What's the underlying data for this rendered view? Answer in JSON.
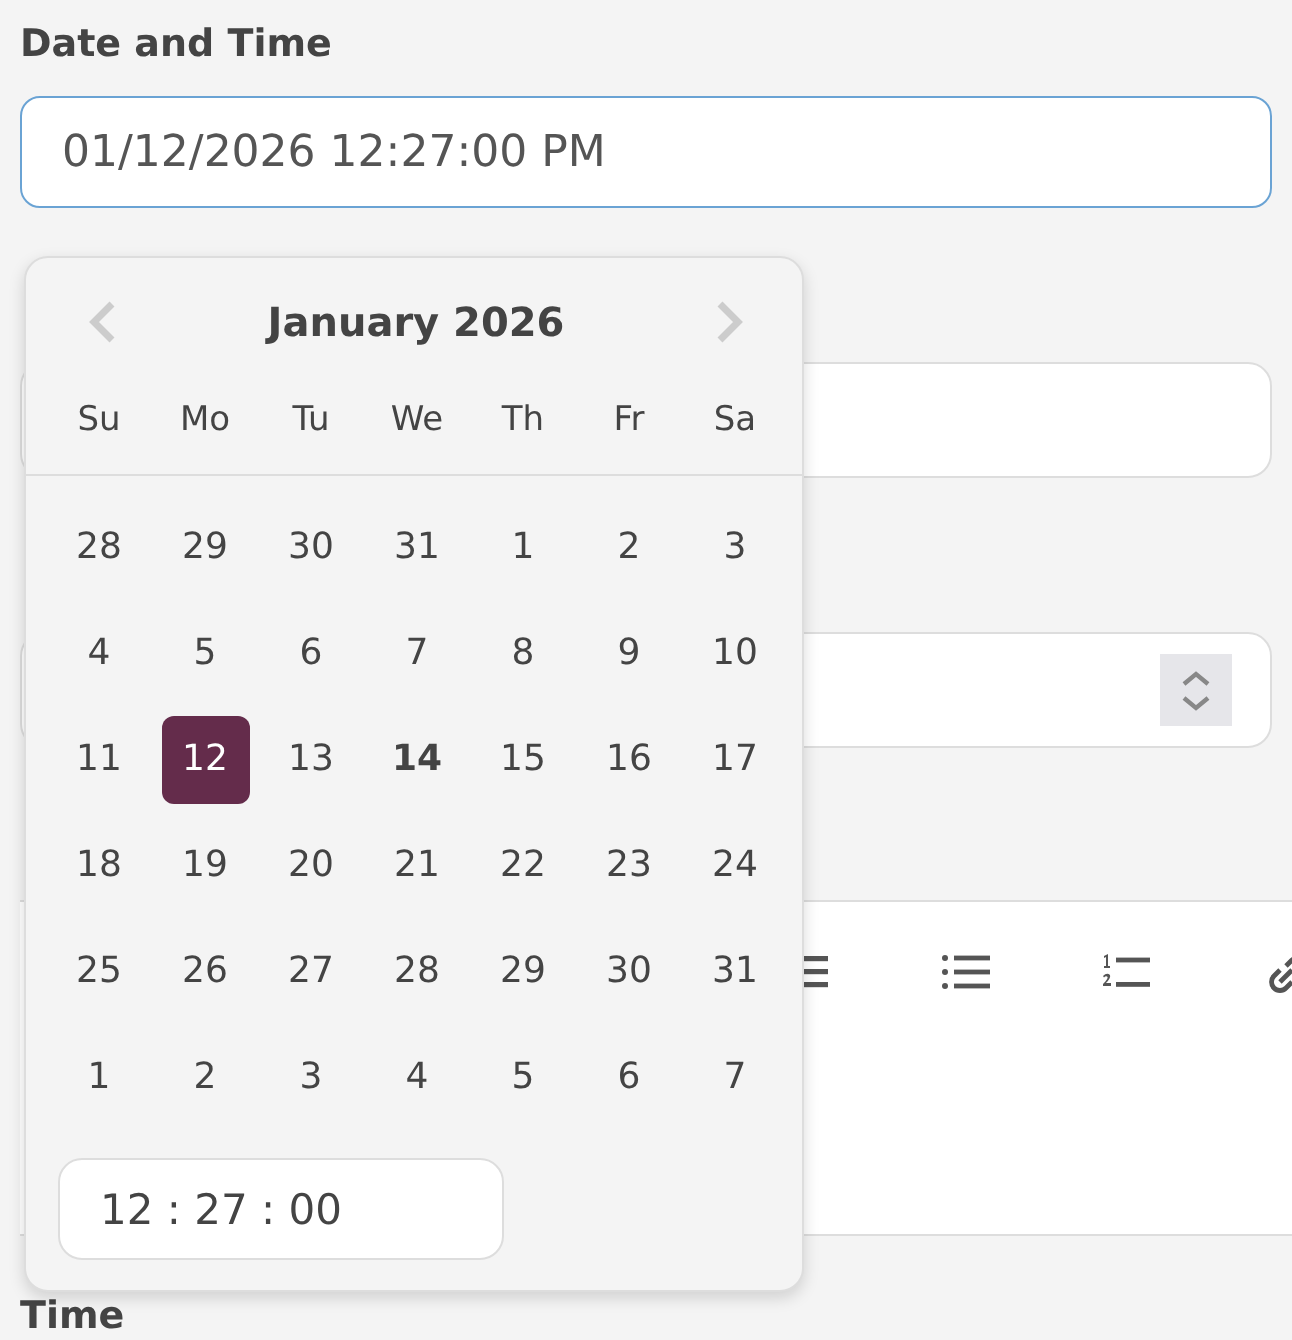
{
  "field": {
    "label": "Date and Time",
    "value": "01/12/2026 12:27:00 PM",
    "focused": true
  },
  "datepicker": {
    "title": "January 2026",
    "weekdays": [
      "Su",
      "Mo",
      "Tu",
      "We",
      "Th",
      "Fr",
      "Sa"
    ],
    "weeks": [
      [
        {
          "day": "28",
          "selected": false,
          "today": false
        },
        {
          "day": "29",
          "selected": false,
          "today": false
        },
        {
          "day": "30",
          "selected": false,
          "today": false
        },
        {
          "day": "31",
          "selected": false,
          "today": false
        },
        {
          "day": "1",
          "selected": false,
          "today": false
        },
        {
          "day": "2",
          "selected": false,
          "today": false
        },
        {
          "day": "3",
          "selected": false,
          "today": false
        }
      ],
      [
        {
          "day": "4",
          "selected": false,
          "today": false
        },
        {
          "day": "5",
          "selected": false,
          "today": false
        },
        {
          "day": "6",
          "selected": false,
          "today": false
        },
        {
          "day": "7",
          "selected": false,
          "today": false
        },
        {
          "day": "8",
          "selected": false,
          "today": false
        },
        {
          "day": "9",
          "selected": false,
          "today": false
        },
        {
          "day": "10",
          "selected": false,
          "today": false
        }
      ],
      [
        {
          "day": "11",
          "selected": false,
          "today": false
        },
        {
          "day": "12",
          "selected": true,
          "today": false
        },
        {
          "day": "13",
          "selected": false,
          "today": false
        },
        {
          "day": "14",
          "selected": false,
          "today": true
        },
        {
          "day": "15",
          "selected": false,
          "today": false
        },
        {
          "day": "16",
          "selected": false,
          "today": false
        },
        {
          "day": "17",
          "selected": false,
          "today": false
        }
      ],
      [
        {
          "day": "18",
          "selected": false,
          "today": false
        },
        {
          "day": "19",
          "selected": false,
          "today": false
        },
        {
          "day": "20",
          "selected": false,
          "today": false
        },
        {
          "day": "21",
          "selected": false,
          "today": false
        },
        {
          "day": "22",
          "selected": false,
          "today": false
        },
        {
          "day": "23",
          "selected": false,
          "today": false
        },
        {
          "day": "24",
          "selected": false,
          "today": false
        }
      ],
      [
        {
          "day": "25",
          "selected": false,
          "today": false
        },
        {
          "day": "26",
          "selected": false,
          "today": false
        },
        {
          "day": "27",
          "selected": false,
          "today": false
        },
        {
          "day": "28",
          "selected": false,
          "today": false
        },
        {
          "day": "29",
          "selected": false,
          "today": false
        },
        {
          "day": "30",
          "selected": false,
          "today": false
        },
        {
          "day": "31",
          "selected": false,
          "today": false
        }
      ],
      [
        {
          "day": "1",
          "selected": false,
          "today": false
        },
        {
          "day": "2",
          "selected": false,
          "today": false
        },
        {
          "day": "3",
          "selected": false,
          "today": false
        },
        {
          "day": "4",
          "selected": false,
          "today": false
        },
        {
          "day": "5",
          "selected": false,
          "today": false
        },
        {
          "day": "6",
          "selected": false,
          "today": false
        },
        {
          "day": "7",
          "selected": false,
          "today": false
        }
      ]
    ],
    "time": "12 : 27 : 00"
  },
  "hidden_fields": [
    {
      "kind": "text"
    },
    {
      "kind": "number"
    }
  ],
  "editor_toolbar": [
    {
      "kind": "align"
    },
    {
      "kind": "bullet-list"
    },
    {
      "kind": "numbered-list"
    },
    {
      "kind": "link"
    }
  ],
  "next_label": "Time"
}
